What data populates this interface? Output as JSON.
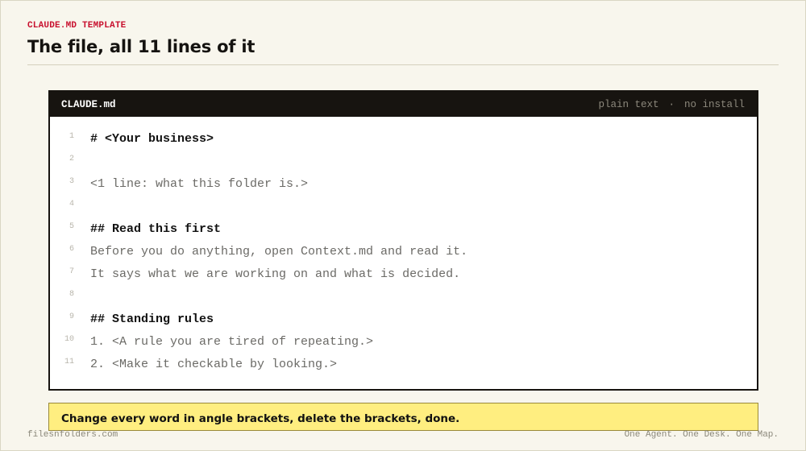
{
  "header": {
    "eyebrow": "CLAUDE.MD TEMPLATE",
    "title": "The file, all 11 lines of it"
  },
  "editor": {
    "filename": "CLAUDE.md",
    "meta_format": "plain text",
    "meta_separator": "·",
    "meta_install": "no install",
    "lines": [
      {
        "num": "1",
        "text": "# <Your business>",
        "style": "heading"
      },
      {
        "num": "2",
        "text": "",
        "style": "plain"
      },
      {
        "num": "3",
        "text": "<1 line: what this folder is.>",
        "style": "plain"
      },
      {
        "num": "4",
        "text": "",
        "style": "plain"
      },
      {
        "num": "5",
        "text": "## Read this first",
        "style": "heading"
      },
      {
        "num": "6",
        "text": "Before you do anything, open Context.md and read it.",
        "style": "plain"
      },
      {
        "num": "7",
        "text": "It says what we are working on and what is decided.",
        "style": "plain"
      },
      {
        "num": "8",
        "text": "",
        "style": "plain"
      },
      {
        "num": "9",
        "text": "## Standing rules",
        "style": "heading"
      },
      {
        "num": "10",
        "text": "1. <A rule you are tired of repeating.>",
        "style": "plain"
      },
      {
        "num": "11",
        "text": "2. <Make it checkable by looking.>",
        "style": "plain"
      }
    ]
  },
  "callout": {
    "text": "Change every word in angle brackets, delete the brackets, done."
  },
  "footer": {
    "left": "filesnfolders.com",
    "right": "One Agent. One Desk. One Map."
  },
  "colors": {
    "background": "#f8f6ed",
    "accent": "#c8102e",
    "editor_bar": "#171410",
    "callout": "#ffee80"
  }
}
